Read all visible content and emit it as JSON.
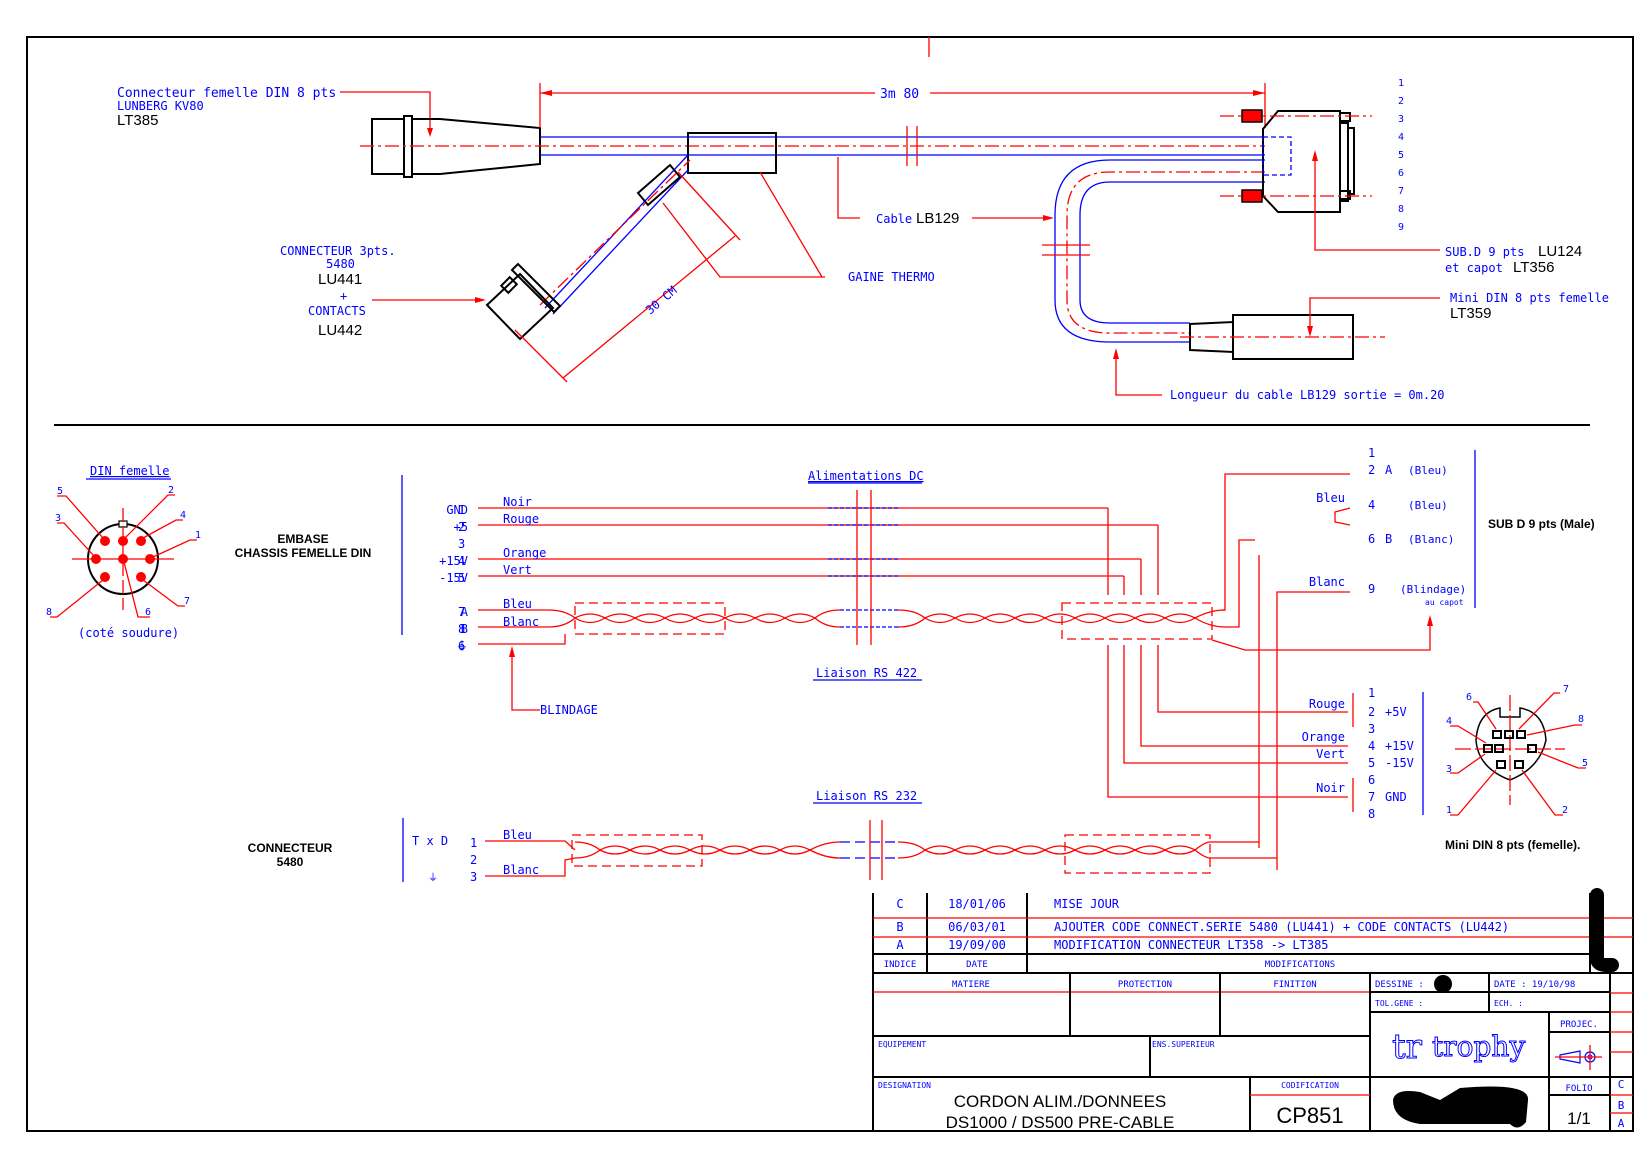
{
  "top_view": {
    "din_connector": {
      "line1": "Connecteur femelle DIN 8 pts",
      "line2": "LUNBERG KV80",
      "ref": "LT385"
    },
    "length_dim": "3m 80",
    "cable_label": "Cable",
    "cable_ref": "LB129",
    "connector_5480": {
      "line1": "CONNECTEUR 3pts.",
      "line2": "5480",
      "ref1": "LU441",
      "plus": "+",
      "line3": "CONTACTS",
      "ref2": "LU442"
    },
    "branch_dim": "30 CM",
    "gaine": "GAINE THERMO",
    "subd": {
      "line1": "SUB.D 9 pts",
      "ref1": "LU124",
      "line2": "et capot",
      "ref2": "LT356"
    },
    "subd_pins": [
      "1",
      "2",
      "3",
      "4",
      "5",
      "6",
      "7",
      "8",
      "9"
    ],
    "minidin": {
      "line1": "Mini DIN 8 pts femelle",
      "ref": "LT359"
    },
    "cable_length_note": "Longueur du cable LB129 sortie = 0m.20"
  },
  "schematic": {
    "din_title": "DIN femelle",
    "din_caption": "(coté soudure)",
    "din_pins": [
      "1",
      "2",
      "3",
      "4",
      "5",
      "6",
      "7",
      "8"
    ],
    "embase": {
      "line1": "EMBASE",
      "line2": "CHASSIS FEMELLE DIN"
    },
    "din_signals": [
      {
        "name": "GND",
        "pin": "1",
        "wire": "Noir"
      },
      {
        "name": "+5",
        "pin": "2",
        "wire": "Rouge"
      },
      {
        "name": "",
        "pin": "3",
        "wire": ""
      },
      {
        "name": "+15V",
        "pin": "4",
        "wire": "Orange"
      },
      {
        "name": "-15V",
        "pin": "5",
        "wire": "Vert"
      },
      {
        "name": "A",
        "pin": "7",
        "wire": "Bleu"
      },
      {
        "name": "B",
        "pin": "8",
        "wire": "Blanc"
      },
      {
        "name": "⏚",
        "pin": "6",
        "wire": ""
      }
    ],
    "blindage": "BLINDAGE",
    "alim_label": "Alimentations DC",
    "rs422_label": "Liaison RS 422",
    "rs232_label": "Liaison RS 232",
    "subd_title": "SUB D 9 pts (Male)",
    "subd_pins": [
      {
        "pin": "1",
        "sig": "",
        "note": ""
      },
      {
        "pin": "2",
        "sig": "A",
        "note": "(Bleu)"
      },
      {
        "pin": "4",
        "sig": "",
        "note": "(Bleu)"
      },
      {
        "pin": "6",
        "sig": "B",
        "note": "(Blanc)"
      },
      {
        "pin": "9",
        "sig": "",
        "note": "(Blindage)"
      }
    ],
    "subd_capot": "au capot",
    "subd_wire_bleu": "Bleu",
    "subd_wire_blanc": "Blanc",
    "minidin_title": "Mini DIN 8 pts (femelle).",
    "minidin_pins": [
      {
        "pin": "1",
        "sig": "",
        "wire": ""
      },
      {
        "pin": "2",
        "sig": "+5V",
        "wire": "Rouge"
      },
      {
        "pin": "3",
        "sig": "",
        "wire": ""
      },
      {
        "pin": "4",
        "sig": "+15V",
        "wire": "Orange"
      },
      {
        "pin": "5",
        "sig": "-15V",
        "wire": "Vert"
      },
      {
        "pin": "6",
        "sig": "",
        "wire": ""
      },
      {
        "pin": "7",
        "sig": "GND",
        "wire": "Noir"
      },
      {
        "pin": "8",
        "sig": "",
        "wire": ""
      }
    ],
    "conn5480": {
      "line1": "CONNECTEUR",
      "line2": "5480",
      "txd": "T x D",
      "pins": [
        "1",
        "2",
        "3"
      ],
      "wire1": "Bleu",
      "wire3": "Blanc"
    }
  },
  "title_block": {
    "revisions": [
      {
        "indice": "C",
        "date": "18/01/06",
        "mod": "MISE JOUR"
      },
      {
        "indice": "B",
        "date": "06/03/01",
        "mod": "AJOUTER CODE CONNECT.SERIE 5480 (LU441) + CODE CONTACTS (LU442)"
      },
      {
        "indice": "A",
        "date": "19/09/00",
        "mod": "MODIFICATION CONNECTEUR LT358 -> LT385"
      }
    ],
    "h_indice": "INDICE",
    "h_date": "DATE",
    "h_modifications": "MODIFICATIONS",
    "matiere": "MATIERE",
    "protection": "PROTECTION",
    "finition": "FINITION",
    "dessine": "DESSINE :",
    "date_label": "DATE : 19/10/98",
    "tolgene": "TOL.GENE :",
    "ech": "ECH. :",
    "equipement": "EQUIPEMENT",
    "ens_superieur": "ENS.SUPERIEUR",
    "logo": "trophy",
    "projec": "PROJEC.",
    "designation_label": "DESIGNATION",
    "designation1": "CORDON ALIM./DONNEES",
    "designation2": "DS1000 / DS500 PRE-CABLE",
    "codification_label": "CODIFICATION",
    "codification": "CP851",
    "folio_label": "FOLIO",
    "folio": "1/1",
    "rev_letters": [
      "C",
      "B",
      "A"
    ]
  }
}
